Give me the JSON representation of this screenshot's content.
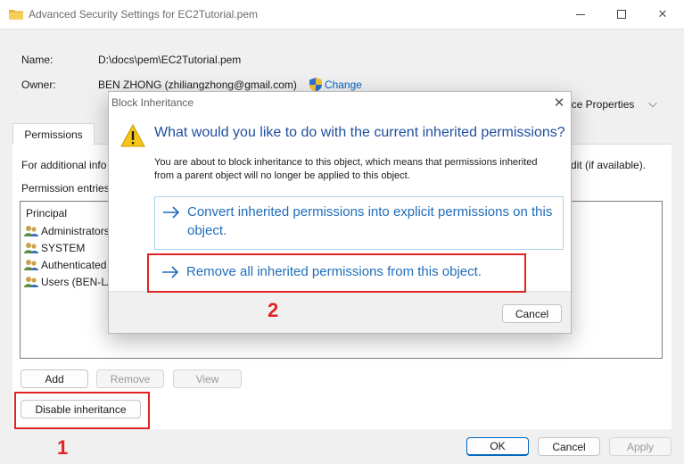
{
  "window": {
    "title": "Advanced Security Settings for EC2Tutorial.pem",
    "minimize": "—",
    "maximize": "",
    "close": "✕"
  },
  "info": {
    "name_label": "Name:",
    "name_value": "D:\\docs\\pem\\EC2Tutorial.pem",
    "owner_label": "Owner:",
    "owner_value": "BEN ZHONG (zhiliangzhong@gmail.com)",
    "change_link": "Change",
    "resource_properties": "urce Properties",
    "resource_chevron": "⌵"
  },
  "tabs": [
    {
      "label": "Permissions"
    }
  ],
  "permissions": {
    "info_text_left": "For additional info",
    "info_text_right": "dit (if available).",
    "entries_label": "Permission entries",
    "column_principal": "Principal",
    "principals": [
      {
        "name": "Administrators"
      },
      {
        "name": "SYSTEM"
      },
      {
        "name": "Authenticated"
      },
      {
        "name": "Users (BEN-LA"
      }
    ]
  },
  "buttons": {
    "add": "Add",
    "remove": "Remove",
    "view": "View",
    "disable_inheritance": "Disable inheritance",
    "ok": "OK",
    "cancel": "Cancel",
    "apply": "Apply"
  },
  "annotations": {
    "step1": "1",
    "step2": "2",
    "highlight_color": "#e02424"
  },
  "dialog": {
    "title": "Block Inheritance",
    "close": "✕",
    "question": "What would you like to do with the current inherited permissions?",
    "description": "You are about to block inheritance to this object, which means that permissions inherited from a parent object will no longer be applied to this object.",
    "option1": "Convert inherited permissions into explicit permissions on this object.",
    "option2": "Remove all inherited permissions from this object.",
    "cancel": "Cancel"
  },
  "colors": {
    "accent": "#0067c0",
    "dialog_heading": "#1f4e9c",
    "option_link": "#1f6dba",
    "annotation_red": "#e02424",
    "warning_yellow": "#f5c518"
  },
  "icons": {
    "window_icon": "folder-icon",
    "owner_change": "shield-icon",
    "principal": "users-icon",
    "dialog_warning": "warning-icon",
    "option": "arrow-right-icon"
  }
}
